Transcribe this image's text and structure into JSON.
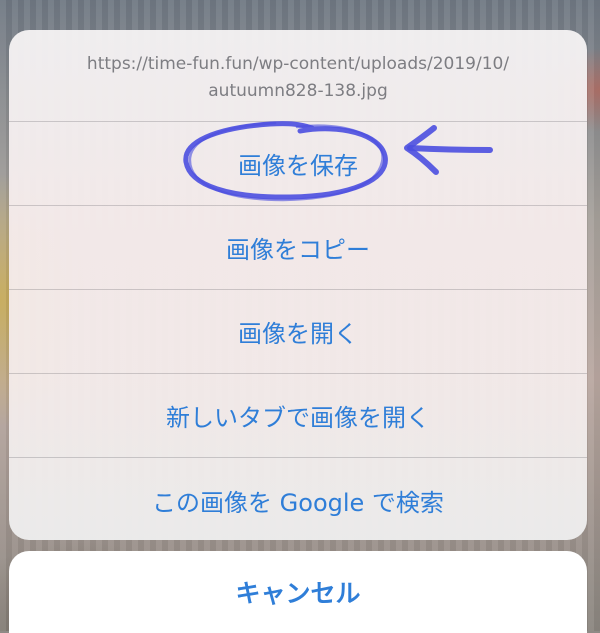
{
  "sheet": {
    "url_line1": "https://time-fun.fun/wp-content/uploads/2019/10/",
    "url_line2": "autuumn828-138.jpg",
    "actions": [
      {
        "label": "画像を保存"
      },
      {
        "label": "画像をコピー"
      },
      {
        "label": "画像を開く"
      },
      {
        "label": "新しいタブで画像を開く"
      },
      {
        "label": "この画像を Google で検索"
      }
    ]
  },
  "cancel": {
    "label": "キャンセル"
  },
  "colors": {
    "action_text": "#2f7ed8",
    "header_text": "#7d7d82",
    "annotation": "#4b4fe0"
  },
  "annotation": {
    "highlighted_action": "画像を保存",
    "marks": [
      "circle",
      "left-arrow"
    ]
  }
}
